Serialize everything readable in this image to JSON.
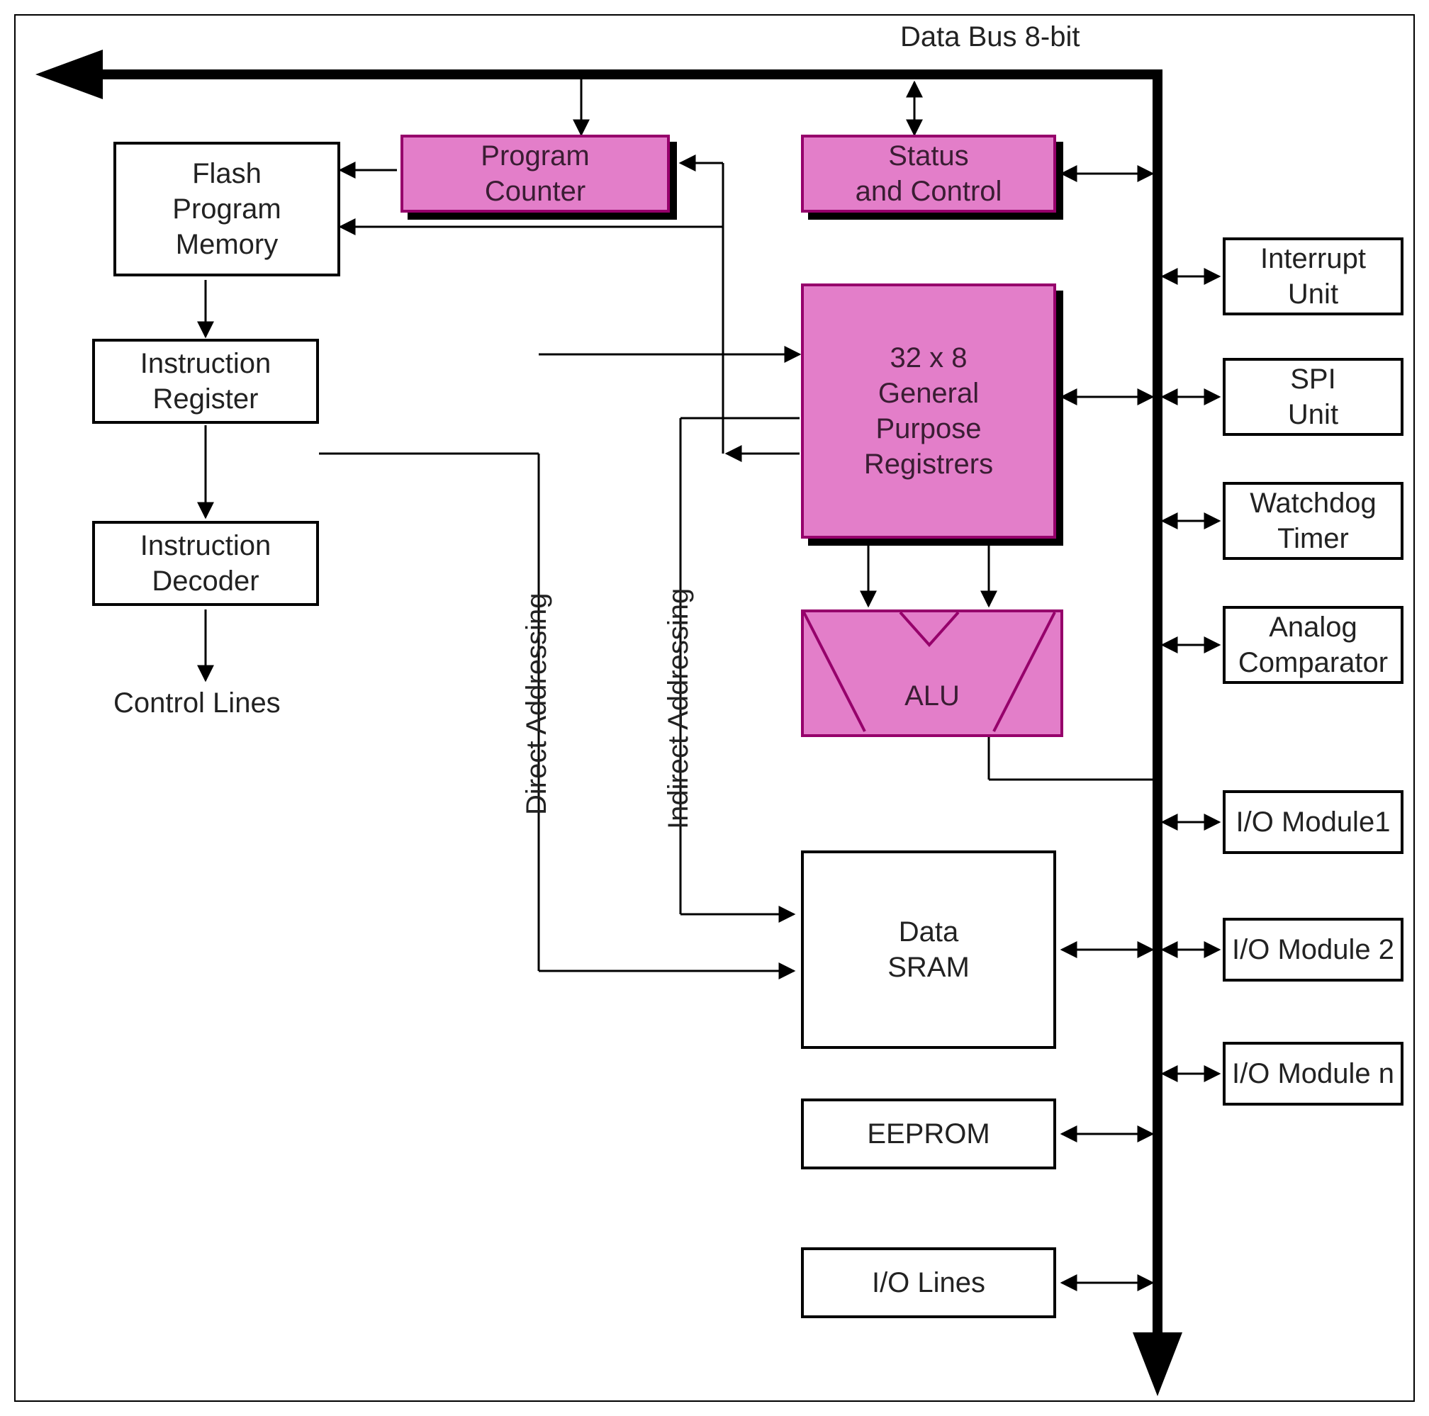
{
  "diagram": {
    "bus_label": "Data Bus 8-bit",
    "blocks": {
      "program_counter": "Program\nCounter",
      "status_control": "Status\nand Control",
      "flash": "Flash\nProgram\nMemory",
      "instr_reg": "Instruction\nRegister",
      "instr_dec": "Instruction\nDecoder",
      "control_lines": "Control Lines",
      "gpr": "32 x 8\nGeneral\nPurpose\nRegistrers",
      "alu": "ALU",
      "data_sram": "Data\nSRAM",
      "eeprom": "EEPROM",
      "io_lines": "I/O Lines",
      "interrupt": "Interrupt\nUnit",
      "spi": "SPI\nUnit",
      "watchdog": "Watchdog\nTimer",
      "analog": "Analog\nComparator",
      "io1": "I/O Module1",
      "io2": "I/O Module 2",
      "ion": "I/O Module n",
      "direct": "Direct Addressing",
      "indirect": "Indirect Addressing"
    },
    "colors": {
      "highlight_fill": "#e37ec9",
      "highlight_stroke": "#96006b"
    }
  }
}
